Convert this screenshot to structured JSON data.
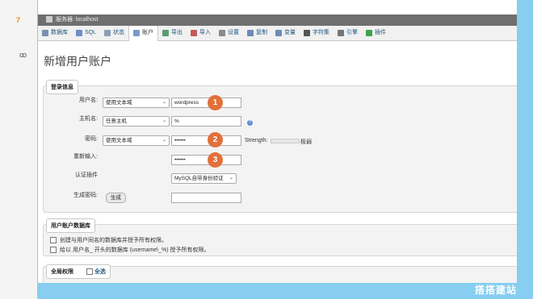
{
  "left_strip": {
    "orange_text": "7",
    "link_text": "ꝏ"
  },
  "window": {
    "breadcrumb": "服务器: localhost",
    "tabs": [
      {
        "label": "数据库",
        "icon": "database-icon",
        "color": "#7a8fb0"
      },
      {
        "label": "SQL",
        "icon": "sql-icon",
        "color": "#6c8fc4"
      },
      {
        "label": "状态",
        "icon": "status-icon",
        "color": "#8aa0b8"
      },
      {
        "label": "账户",
        "icon": "accounts-icon",
        "color": "#7a9bc8"
      },
      {
        "label": "导出",
        "icon": "export-icon",
        "color": "#5a9c6e"
      },
      {
        "label": "导入",
        "icon": "import-icon",
        "color": "#c45a5a"
      },
      {
        "label": "设置",
        "icon": "settings-icon",
        "color": "#8b8b8b"
      },
      {
        "label": "复制",
        "icon": "replication-icon",
        "color": "#6e8bb8"
      },
      {
        "label": "变量",
        "icon": "variables-icon",
        "color": "#6e8bb8"
      },
      {
        "label": "字符集",
        "icon": "charset-icon",
        "color": "#555555"
      },
      {
        "label": "引擎",
        "icon": "engines-icon",
        "color": "#777777"
      },
      {
        "label": "插件",
        "icon": "plugins-icon",
        "color": "#3fa34d"
      }
    ],
    "active_tab_index": 3,
    "page_title": "新增用户账户",
    "login_info": {
      "legend": "登录信息",
      "username_label": "用户名:",
      "username_select": "使用文本域",
      "username_value": "wordpress",
      "host_label": "主机名:",
      "host_select": "任意主机",
      "host_value": "%",
      "password_label": "密码:",
      "password_select": "使用文本域",
      "password_value": "••••••",
      "strength_label": "Strength:",
      "strength_text": "极弱",
      "retype_label": "重新输入:",
      "retype_value": "••••••",
      "auth_label": "认证插件",
      "auth_select": "MySQL自带身份验证",
      "generate_label": "生成密码:",
      "generate_button": "生成"
    },
    "markers": [
      "1",
      "2",
      "3"
    ],
    "user_db": {
      "legend": "用户账户数据库",
      "option1": "创建与用户同名的数据库并授予所有权限。",
      "option2": "给以 用户名_ 开头的数据库 (username\\_%) 授予所有权限。"
    },
    "global_priv": {
      "legend": "全局权限",
      "check_all": "全选"
    }
  },
  "watermark": "搭搭建站",
  "colors": {
    "background": "#87cef0",
    "marker": "#e2703a",
    "link": "#235a81"
  }
}
